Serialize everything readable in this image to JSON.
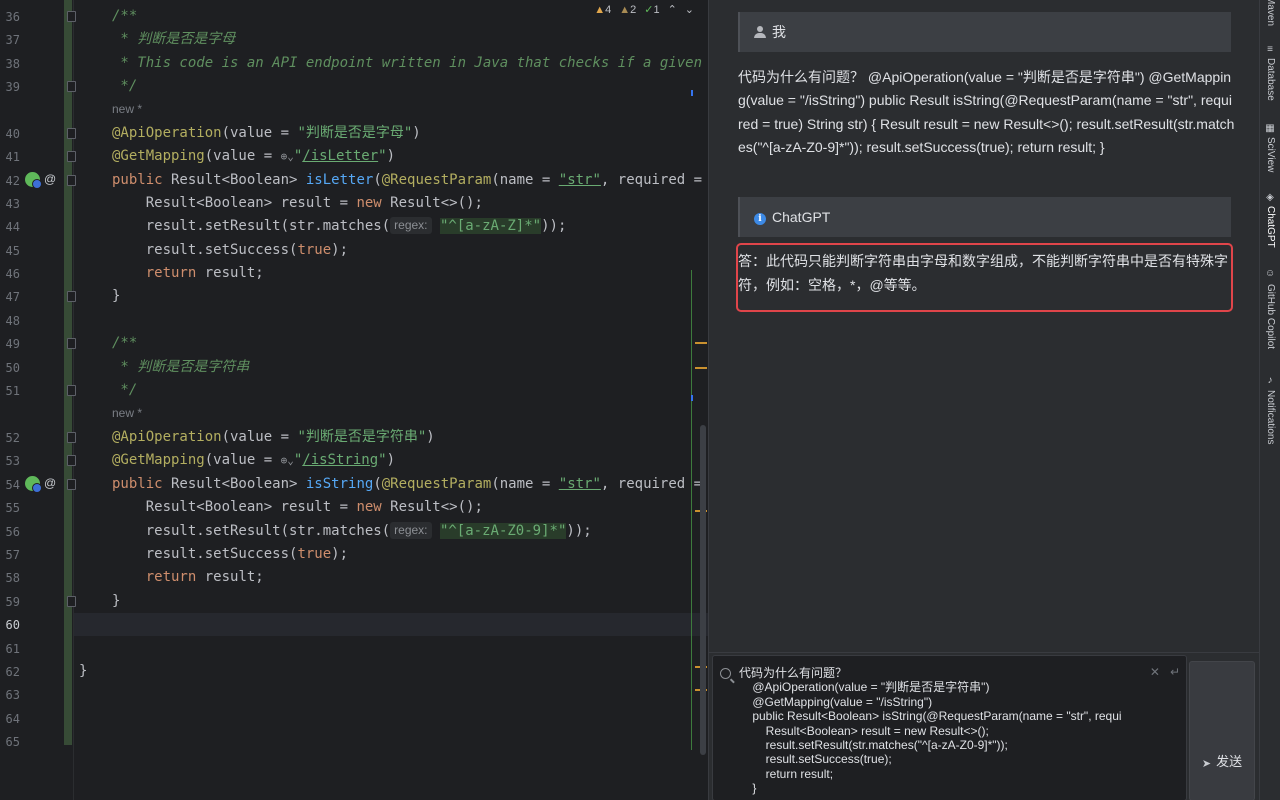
{
  "editor": {
    "inspections": {
      "warnings": "4",
      "weak_warnings": "2",
      "typos": "1"
    },
    "lines": [
      {
        "n": "36"
      },
      {
        "n": "37"
      },
      {
        "n": "38"
      },
      {
        "n": "39"
      },
      {
        "n": "40"
      },
      {
        "n": "41"
      },
      {
        "n": "42"
      },
      {
        "n": "43"
      },
      {
        "n": "44"
      },
      {
        "n": "45"
      },
      {
        "n": "46"
      },
      {
        "n": "47"
      },
      {
        "n": "48"
      },
      {
        "n": "49"
      },
      {
        "n": "50"
      },
      {
        "n": "51"
      },
      {
        "n": "52"
      },
      {
        "n": "53"
      },
      {
        "n": "54"
      },
      {
        "n": "55"
      },
      {
        "n": "56"
      },
      {
        "n": "57"
      },
      {
        "n": "58"
      },
      {
        "n": "59"
      },
      {
        "n": "60"
      },
      {
        "n": "61"
      },
      {
        "n": "62"
      },
      {
        "n": "63"
      },
      {
        "n": "64"
      },
      {
        "n": "65"
      }
    ],
    "code": {
      "l36": "/**",
      "l37": " * 判断是否是字母",
      "l38": " * This code is an API endpoint written in Java that checks if a given str",
      "l39": " */",
      "new_label": "new *",
      "l40_ann": "@ApiOperation",
      "l40_rest": "(value = ",
      "l40_str": "\"判断是否是字母\"",
      "l40_end": ")",
      "l41_ann": "@GetMapping",
      "l41_rest": "(value = ",
      "l41_str_q": "\"",
      "l41_str": "/isLetter",
      "l41_end": ")",
      "kw_public": "public",
      "l42_type": " Result<Boolean> ",
      "l42_fn": "isLetter",
      "l42_p1": "(",
      "l42_ann": "@RequestParam",
      "l42_p2": "(name = ",
      "l42_str": "\"str\"",
      "l42_p3": ", required = tru",
      "l43_a": "    Result<Boolean> result = ",
      "kw_new": "new",
      "l43_b": " Result<>();",
      "l44_a": "    result.setResult(str.matches(",
      "regex_hint": "regex:",
      "l44_rx": "\"^[a-zA-Z]*\"",
      "l44_b": "));",
      "l45_a": "    result.setSuccess(",
      "kw_true": "true",
      "l45_b": ");",
      "kw_return": "return",
      "l46_b": " result;",
      "l47": "}",
      "l49": "/**",
      "l50": " * 判断是否是字符串",
      "l51": " */",
      "l52_str": "\"判断是否是字符串\"",
      "l53_str": "/isString",
      "l54_fn": "isString",
      "l56_rx": "\"^[a-zA-Z0-9]*\"",
      "l59": "}",
      "l62": "}"
    }
  },
  "chat": {
    "user_label": "我",
    "question": "代码为什么有问题？ @ApiOperation(value = \"判断是否是字符串\") @GetMapping(value = \"/isString\") public Result isString(@RequestParam(name = \"str\", required = true) String str) { Result result = new Result<>(); result.setResult(str.matches(\"^[a-zA-Z0-9]*\")); result.setSuccess(true); return result; }",
    "bot_label": "ChatGPT",
    "answer": "答：此代码只能判断字符串由字母和数字组成，不能判断字符串中是否有特殊字符，例如：空格，*，@等等。",
    "input_text": "代码为什么有问题？\n    @ApiOperation(value = \"判断是否是字符串\")\n    @GetMapping(value = \"/isString\")\n    public Result<Boolean> isString(@RequestParam(name = \"str\", requi\n        Result<Boolean> result = new Result<>();\n        result.setResult(str.matches(\"^[a-zA-Z0-9]*\"));\n        result.setSuccess(true);\n        return result;\n    }",
    "send_label": "发送"
  },
  "toolstrip": {
    "tabs": [
      "Maven",
      "Database",
      "SciView",
      "ChatGPT",
      "GitHub Copilot",
      "Notifications"
    ]
  },
  "colors": {
    "accent_red": "#e0454a",
    "editor_bg": "#1e1f22",
    "panel_bg": "#2b2d30"
  }
}
